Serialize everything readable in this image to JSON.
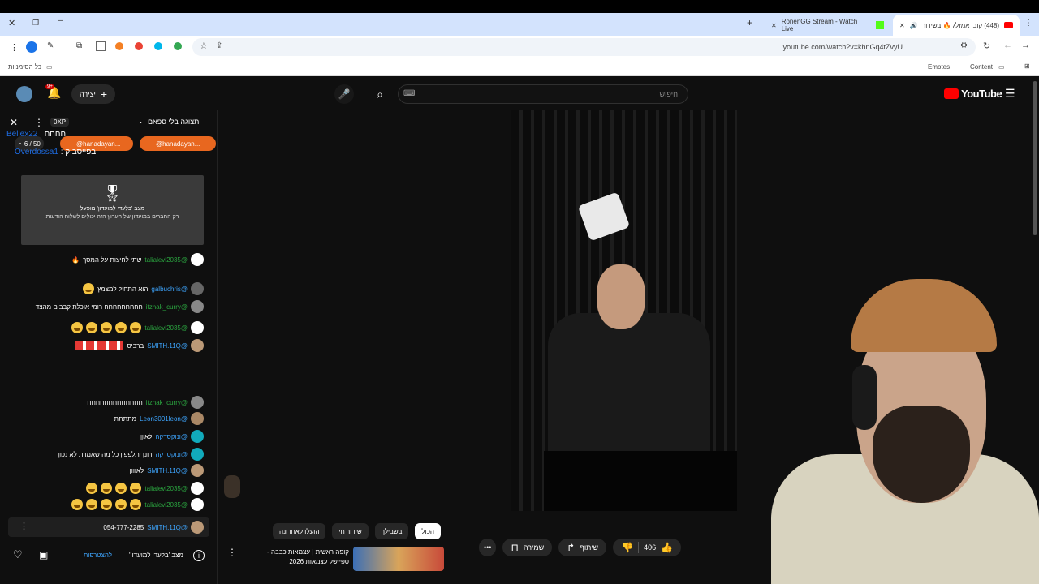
{
  "browser": {
    "tabs": [
      {
        "label": "(448) קובי אמזלג 🔥 בשידור",
        "active": true
      },
      {
        "label": "RonenGG Stream - Watch Live",
        "active": false
      }
    ],
    "url": "youtube.com/watch?v=khnGq4tZvyU",
    "bookmarks": {
      "all": "כל הסימניות",
      "emotes": "Emotes",
      "content": "Content"
    }
  },
  "youtube": {
    "logo": "YouTube",
    "search_placeholder": "חיפוש",
    "create_label": "יצירה",
    "notif_count": "9+"
  },
  "chat": {
    "header": "תצוגה בלי ספאם",
    "xp": "0XP",
    "poll_count": "6 / 50",
    "pinned1": "@hanadayan...",
    "pinned2": "@hanadayan...",
    "ticker1_user": "Bellex22",
    "ticker1_text": "חחחח",
    "ticker2_user": "Overdossa1",
    "ticker2_text": "בפייסבוק",
    "members_title": "מצב 'בלעדי למועדון' מופעל",
    "members_desc": "רק החברים במועדון של הערוץ הזה יכולים לשלוח הודעות",
    "messages": [
      {
        "user": "@talialevi2035",
        "text": "שתי לחיצות על המסך",
        "green": true
      },
      {
        "user": "@galbuchris",
        "text": "הוא התחיל למצמץ",
        "green": false
      },
      {
        "user": "@itzhak_curry",
        "text": "חחחחחחחחח רומי אוכלת קבבים מהצד",
        "green": true
      },
      {
        "user": "@talialevi2035",
        "text": "",
        "green": true
      },
      {
        "user": "@SMITH.11Q",
        "text": "ברביס",
        "green": false
      },
      {
        "user": "@itzhak_curry",
        "text": "חחחחחחחחחחחחח",
        "green": true
      },
      {
        "user": "@Leon3001leon",
        "text": "מתתתת",
        "green": false
      },
      {
        "user": "@ונוקסדקה",
        "text": "לאוןן",
        "green": false
      },
      {
        "user": "@ונוקסדקה",
        "text": "רונן יתלפפון כל מה שאמרת לא נכון",
        "green": false
      },
      {
        "user": "@SMITH.11Q",
        "text": "לאווון",
        "green": false
      },
      {
        "user": "@talialevi2035",
        "text": "",
        "green": true
      },
      {
        "user": "@talialevi2035",
        "text": "",
        "green": true
      },
      {
        "user": "@SMITH.11Q",
        "text": "054-777-2285",
        "green": false
      }
    ],
    "footer_mode": "מצב 'בלעדי למועדון'",
    "footer_join": "להצטרפות"
  },
  "below": {
    "chips": [
      "הכול",
      "בשבילך",
      "שידור חי",
      "הועלו לאחרונה"
    ],
    "likes": "406",
    "share": "שיתוף",
    "save": "שמירה",
    "related_title1": "קופה ראשית | עצמאות כבבה -",
    "related_title2": "ספיישל עצמאות 2026"
  }
}
